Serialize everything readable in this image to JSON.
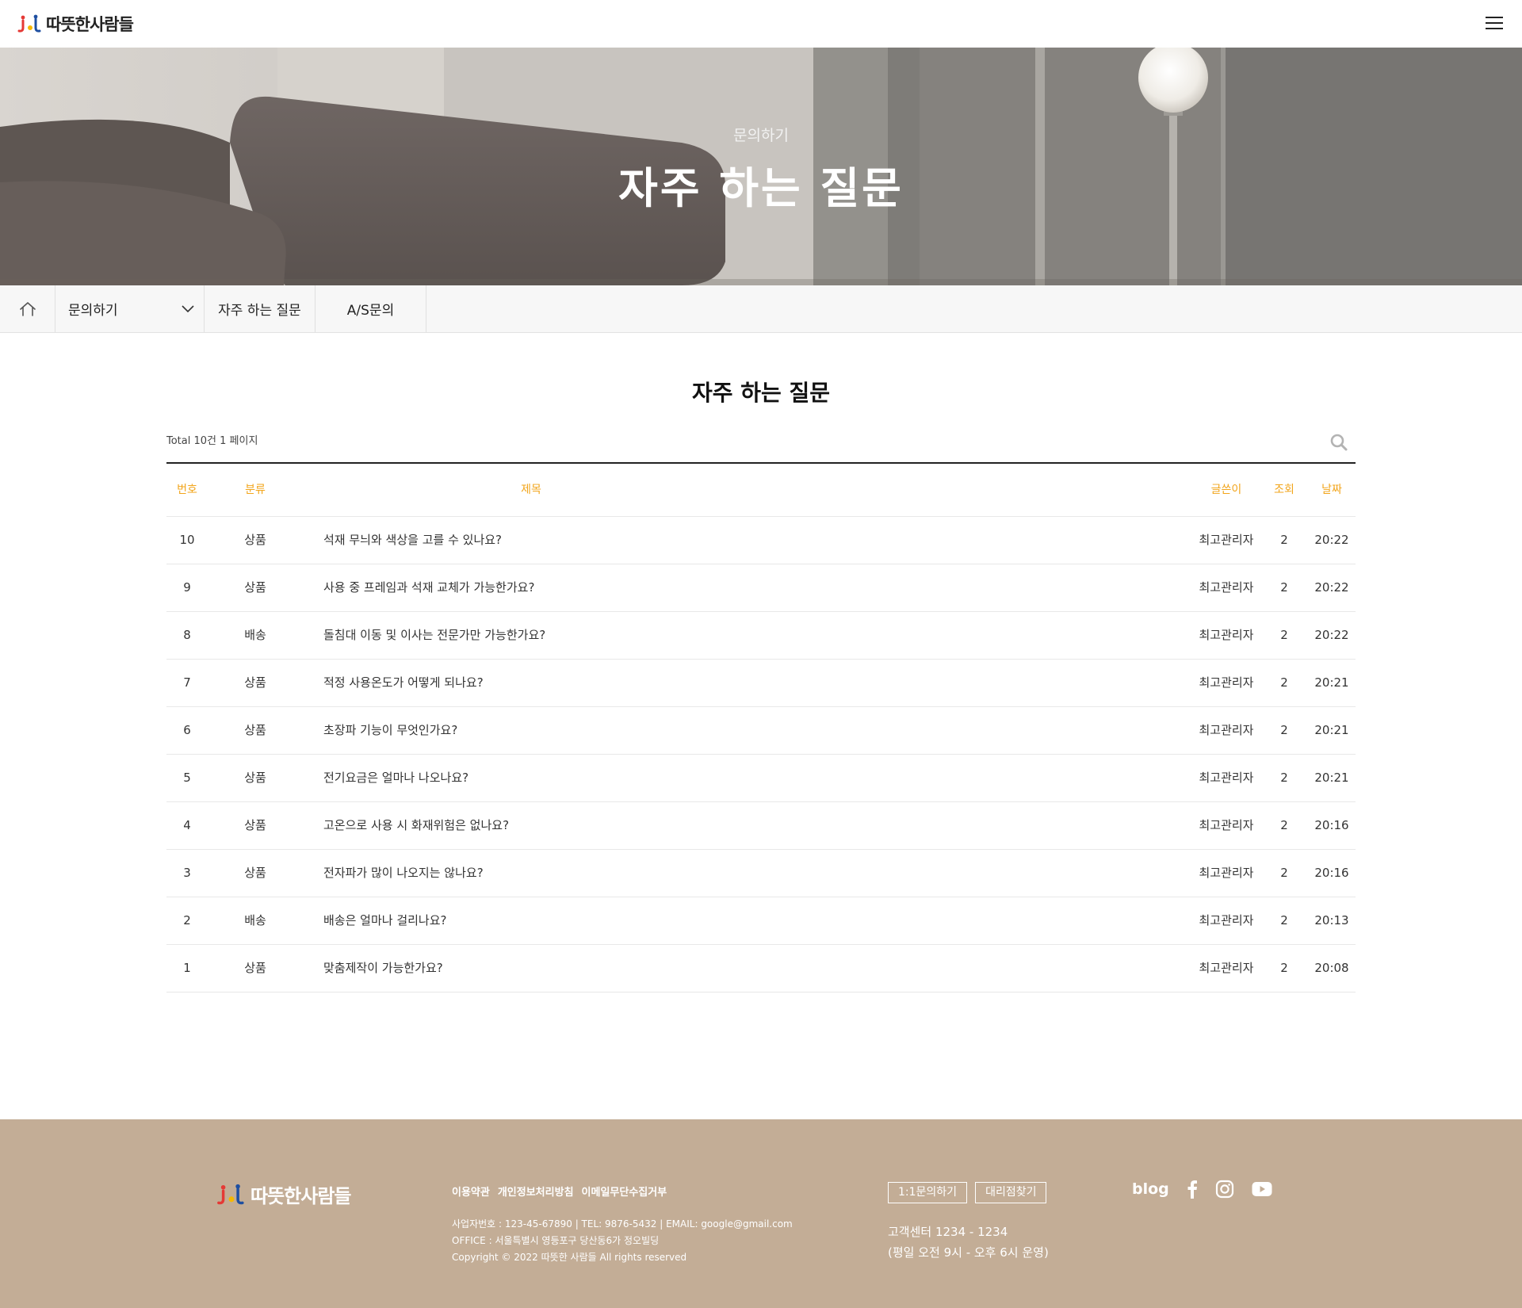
{
  "header": {
    "logo_text": "따뜻한사람들",
    "menu_icon": "hamburger-icon"
  },
  "hero": {
    "subtitle": "문의하기",
    "title": "자주 하는 질문"
  },
  "subnav": {
    "home_icon": "home-icon",
    "dropdown_label": "문의하기",
    "items": [
      "자주 하는 질문",
      "A/S문의"
    ]
  },
  "board": {
    "title": "자주 하는 질문",
    "total_text": "Total 10건 1 페이지",
    "search_icon": "search-icon",
    "columns": {
      "num": "번호",
      "category": "분류",
      "title": "제목",
      "writer": "글쓴이",
      "hits": "조회",
      "date": "날짜"
    },
    "rows": [
      {
        "num": "10",
        "category": "상품",
        "title": "석재 무늬와 색상을 고를 수 있나요?",
        "writer": "최고관리자",
        "hits": "2",
        "date": "20:22"
      },
      {
        "num": "9",
        "category": "상품",
        "title": "사용 중 프레임과 석재 교체가 가능한가요?",
        "writer": "최고관리자",
        "hits": "2",
        "date": "20:22"
      },
      {
        "num": "8",
        "category": "배송",
        "title": "돌침대 이동 및 이사는 전문가만 가능한가요?",
        "writer": "최고관리자",
        "hits": "2",
        "date": "20:22"
      },
      {
        "num": "7",
        "category": "상품",
        "title": "적정 사용온도가 어떻게 되나요?",
        "writer": "최고관리자",
        "hits": "2",
        "date": "20:21"
      },
      {
        "num": "6",
        "category": "상품",
        "title": "초장파 기능이 무엇인가요?",
        "writer": "최고관리자",
        "hits": "2",
        "date": "20:21"
      },
      {
        "num": "5",
        "category": "상품",
        "title": "전기요금은 얼마나 나오나요?",
        "writer": "최고관리자",
        "hits": "2",
        "date": "20:21"
      },
      {
        "num": "4",
        "category": "상품",
        "title": "고온으로 사용 시 화재위험은 없나요?",
        "writer": "최고관리자",
        "hits": "2",
        "date": "20:16"
      },
      {
        "num": "3",
        "category": "상품",
        "title": "전자파가 많이 나오지는 않나요?",
        "writer": "최고관리자",
        "hits": "2",
        "date": "20:16"
      },
      {
        "num": "2",
        "category": "배송",
        "title": "배송은 얼마나 걸리나요?",
        "writer": "최고관리자",
        "hits": "2",
        "date": "20:13"
      },
      {
        "num": "1",
        "category": "상품",
        "title": "맞춤제작이 가능한가요?",
        "writer": "최고관리자",
        "hits": "2",
        "date": "20:08"
      }
    ]
  },
  "footer": {
    "logo_text": "따뜻한사람들",
    "links": [
      "이용약관",
      "개인정보처리방침",
      "이메일무단수집거부"
    ],
    "info_lines": [
      "사업자번호 : 123-45-67890  |  TEL: 9876-5432  |  EMAIL: google@gmail.com",
      "OFFICE : 서울특별시 영등포구 당산동6가 정오빌딩",
      "Copyright © 2022 따뜻한 사람들 All rights reserved"
    ],
    "buttons": [
      "1:1문의하기",
      "대리점찾기"
    ],
    "cs_lines": [
      "고객센터 1234 - 1234",
      "(평일 오전 9시 - 오후 6시 운영)"
    ],
    "social": {
      "blog": "blog",
      "icons": [
        "facebook-icon",
        "instagram-icon",
        "youtube-icon"
      ]
    }
  },
  "colors": {
    "accent": "#f2a51b",
    "footer_bg": "#c3ad96"
  }
}
